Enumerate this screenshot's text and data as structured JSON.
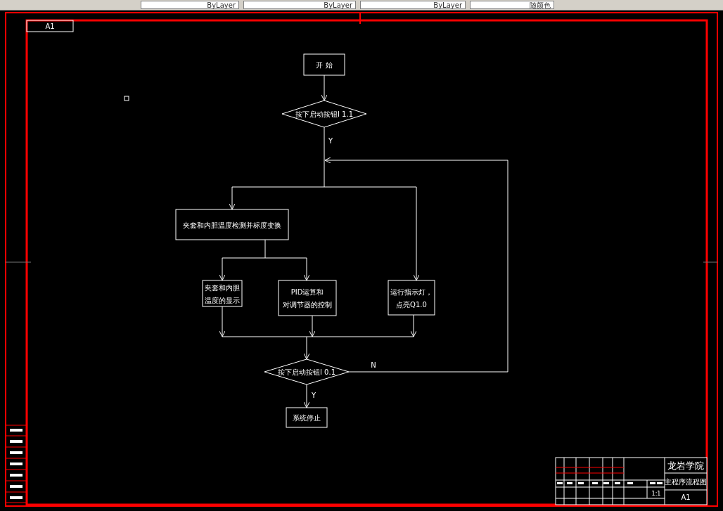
{
  "toolbar": {
    "dropdowns": [
      {
        "value": "ByLayer"
      },
      {
        "value": "ByLayer"
      },
      {
        "value": "ByLayer"
      },
      {
        "value": "随颜色"
      }
    ]
  },
  "sheet": {
    "size_label": "A1"
  },
  "flowchart": {
    "nodes": [
      {
        "kind": "terminal",
        "lines": [
          "开 始"
        ]
      },
      {
        "kind": "decision",
        "lines": [
          "按下启动按钮I 1.1"
        ]
      },
      {
        "kind": "process",
        "lines": [
          "夹套和内胆温度检测并标度变换"
        ]
      },
      {
        "kind": "process",
        "lines": [
          "夹套和内胆",
          "温度的显示"
        ]
      },
      {
        "kind": "process",
        "lines": [
          "PID运算和",
          "对调节器的控制"
        ]
      },
      {
        "kind": "process",
        "lines": [
          "运行指示灯，",
          "点亮Q1.0"
        ]
      },
      {
        "kind": "decision",
        "lines": [
          "按下启动按钮I 0.1"
        ]
      },
      {
        "kind": "process",
        "lines": [
          "系统停止"
        ]
      }
    ],
    "edge_labels": [
      "Y",
      "N",
      "Y"
    ]
  },
  "title_block": {
    "school": "龙岩学院",
    "drawing_title": "主程序流程图",
    "scale": "1:1",
    "sheet_size": "A1"
  }
}
